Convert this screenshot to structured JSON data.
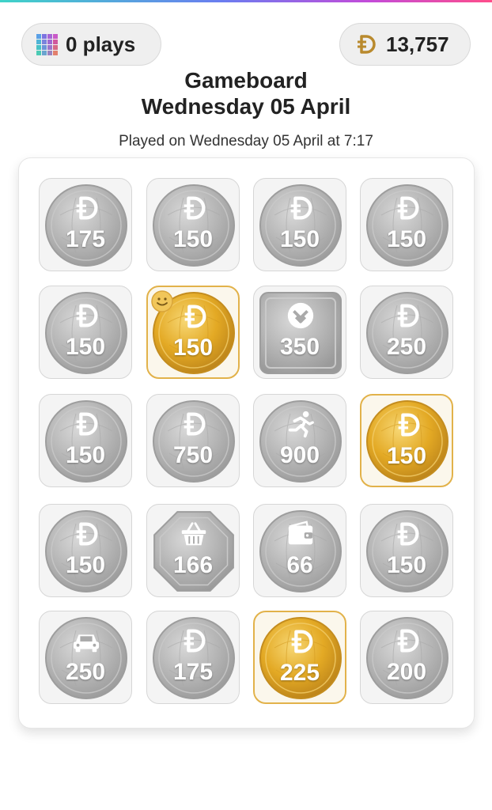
{
  "header": {
    "plays_label": "0 plays",
    "balance": "13,757"
  },
  "title": {
    "line1": "Gameboard",
    "line2": "Wednesday 05 April"
  },
  "subtitle": "Played on Wednesday 05 April at 7:17",
  "colors": {
    "gold": "#e2b24a",
    "silver": "#b5b5b5",
    "tile_bg": "#f4f4f4"
  },
  "tiles": [
    {
      "value": "175",
      "icon": "coin-icon",
      "shape": "circle",
      "won": false
    },
    {
      "value": "150",
      "icon": "coin-icon",
      "shape": "circle",
      "won": false
    },
    {
      "value": "150",
      "icon": "coin-icon",
      "shape": "circle",
      "won": false
    },
    {
      "value": "150",
      "icon": "coin-icon",
      "shape": "circle",
      "won": false
    },
    {
      "value": "150",
      "icon": "coin-icon",
      "shape": "circle",
      "won": false
    },
    {
      "value": "150",
      "icon": "coin-icon",
      "shape": "circle",
      "won": true,
      "badge": "smiley-icon"
    },
    {
      "value": "350",
      "icon": "chevron-badge-icon",
      "shape": "square",
      "won": false
    },
    {
      "value": "250",
      "icon": "coin-icon",
      "shape": "circle",
      "won": false
    },
    {
      "value": "150",
      "icon": "coin-icon",
      "shape": "circle",
      "won": false
    },
    {
      "value": "750",
      "icon": "coin-icon",
      "shape": "circle",
      "won": false
    },
    {
      "value": "900",
      "icon": "runner-icon",
      "shape": "circle",
      "won": false
    },
    {
      "value": "150",
      "icon": "coin-icon",
      "shape": "circle",
      "won": true
    },
    {
      "value": "150",
      "icon": "coin-icon",
      "shape": "circle",
      "won": false
    },
    {
      "value": "166",
      "icon": "basket-icon",
      "shape": "octagon",
      "won": false
    },
    {
      "value": "66",
      "icon": "wallet-icon",
      "shape": "circle",
      "won": false
    },
    {
      "value": "150",
      "icon": "coin-icon",
      "shape": "circle",
      "won": false
    },
    {
      "value": "250",
      "icon": "car-icon",
      "shape": "circle",
      "won": false
    },
    {
      "value": "175",
      "icon": "coin-icon",
      "shape": "circle",
      "won": false
    },
    {
      "value": "225",
      "icon": "coin-icon",
      "shape": "circle",
      "won": true
    },
    {
      "value": "200",
      "icon": "coin-icon",
      "shape": "circle",
      "won": false
    }
  ]
}
